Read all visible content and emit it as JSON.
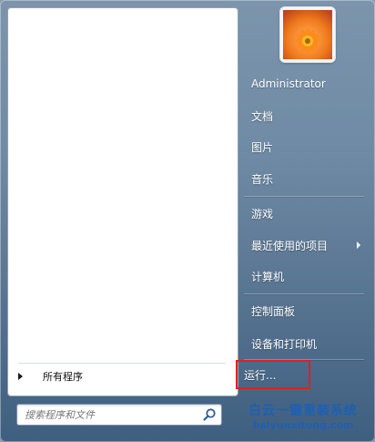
{
  "start_menu": {
    "all_programs_label": "所有程序",
    "search": {
      "placeholder": "搜索程序和文件",
      "value": ""
    },
    "user_name": "Administrator",
    "right_items": [
      {
        "label": "文档"
      },
      {
        "label": "图片"
      },
      {
        "label": "音乐"
      },
      {
        "label": "游戏"
      },
      {
        "label": "最近使用的项目",
        "has_submenu": true
      },
      {
        "label": "计算机"
      },
      {
        "label": "控制面板"
      },
      {
        "label": "设备和打印机"
      },
      {
        "label": "运行...",
        "highlighted": true
      }
    ]
  },
  "watermark": {
    "line1": "白云一键重装系统",
    "line2": "baiyunxitong.com"
  },
  "colors": {
    "highlight_box": "#e02020",
    "accent_blue": "#1f5fb4"
  },
  "icons": {
    "search": "search-icon",
    "user_picture": "flower-avatar-icon"
  }
}
